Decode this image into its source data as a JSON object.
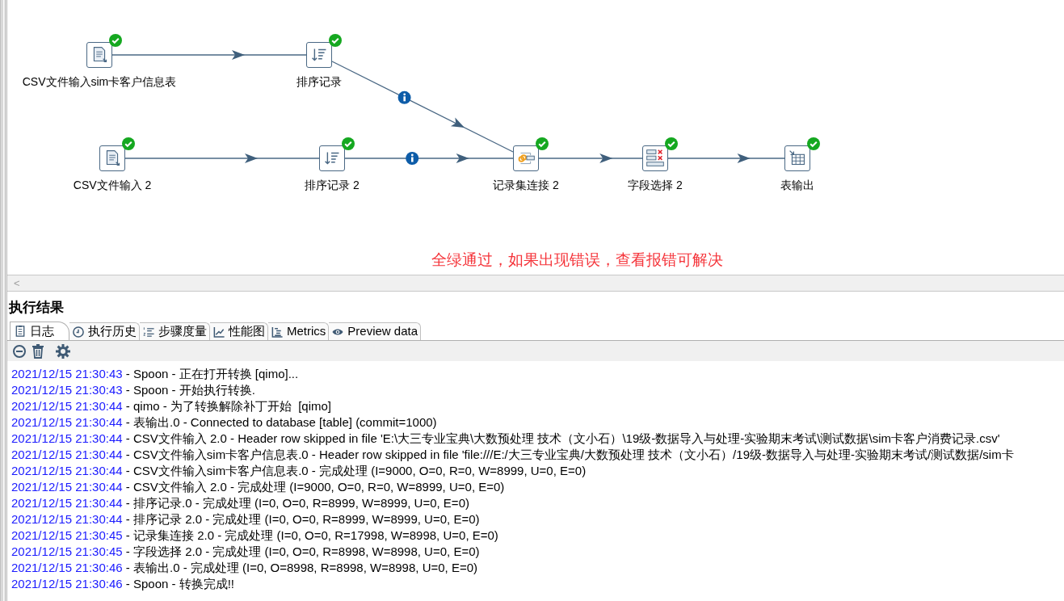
{
  "canvas": {
    "nodes": [
      {
        "label": "CSV文件输入sim卡客户信息表",
        "kind": "csv",
        "ok": true
      },
      {
        "label": "排序记录",
        "kind": "sort",
        "ok": true
      },
      {
        "label": "CSV文件输入 2",
        "kind": "csv",
        "ok": true
      },
      {
        "label": "排序记录 2",
        "kind": "sort",
        "ok": true
      },
      {
        "label": "记录集连接 2",
        "kind": "join",
        "ok": true
      },
      {
        "label": "字段选择 2",
        "kind": "select",
        "ok": true
      },
      {
        "label": "表输出",
        "kind": "output",
        "ok": true
      }
    ],
    "hops": [
      {
        "info": false
      },
      {
        "info": true
      },
      {
        "info": false
      },
      {
        "info": true
      },
      {
        "info": false
      },
      {
        "info": false
      }
    ],
    "note": "全绿通过，如果出现错误，查看报错可解决"
  },
  "scrollbar": {
    "left_arrow": "<"
  },
  "results": {
    "title": "执行结果",
    "tabs": [
      {
        "label": "日志",
        "selected": true
      },
      {
        "label": "执行历史",
        "selected": false
      },
      {
        "label": "步骤度量",
        "selected": false
      },
      {
        "label": "性能图",
        "selected": false
      },
      {
        "label": "Metrics",
        "selected": false
      },
      {
        "label": "Preview data",
        "selected": false
      }
    ],
    "log": [
      {
        "time": "2021/12/15 21:30:43",
        "text": " - Spoon - 正在打开转换 [qimo]..."
      },
      {
        "time": "2021/12/15 21:30:43",
        "text": " - Spoon - 开始执行转换."
      },
      {
        "time": "2021/12/15 21:30:44",
        "text": " - qimo - 为了转换解除补丁开始  [qimo]"
      },
      {
        "time": "2021/12/15 21:30:44",
        "text": " - 表输出.0 - Connected to database [table] (commit=1000)"
      },
      {
        "time": "2021/12/15 21:30:44",
        "text": " - CSV文件输入 2.0 - Header row skipped in file 'E:\\大三专业宝典\\大数预处理 技术（文小石）\\19级-数据导入与处理-实验期末考试\\测试数据\\sim卡客户消费记录.csv'"
      },
      {
        "time": "2021/12/15 21:30:44",
        "text": " - CSV文件输入sim卡客户信息表.0 - Header row skipped in file 'file:///E:/大三专业宝典/大数预处理 技术（文小石）/19级-数据导入与处理-实验期末考试/测试数据/sim卡"
      },
      {
        "time": "2021/12/15 21:30:44",
        "text": " - CSV文件输入sim卡客户信息表.0 - 完成处理 (I=9000, O=0, R=0, W=8999, U=0, E=0)"
      },
      {
        "time": "2021/12/15 21:30:44",
        "text": " - CSV文件输入 2.0 - 完成处理 (I=9000, O=0, R=0, W=8999, U=0, E=0)"
      },
      {
        "time": "2021/12/15 21:30:44",
        "text": " - 排序记录.0 - 完成处理 (I=0, O=0, R=8999, W=8999, U=0, E=0)"
      },
      {
        "time": "2021/12/15 21:30:44",
        "text": " - 排序记录 2.0 - 完成处理 (I=0, O=0, R=8999, W=8999, U=0, E=0)"
      },
      {
        "time": "2021/12/15 21:30:45",
        "text": " - 记录集连接 2.0 - 完成处理 (I=0, O=0, R=17998, W=8998, U=0, E=0)"
      },
      {
        "time": "2021/12/15 21:30:45",
        "text": " - 字段选择 2.0 - 完成处理 (I=0, O=0, R=8998, W=8998, U=0, E=0)"
      },
      {
        "time": "2021/12/15 21:30:46",
        "text": " - 表输出.0 - 完成处理 (I=0, O=8998, R=8998, W=8998, U=0, E=0)"
      },
      {
        "time": "2021/12/15 21:30:46",
        "text": " - Spoon - 转换完成!!"
      }
    ]
  }
}
